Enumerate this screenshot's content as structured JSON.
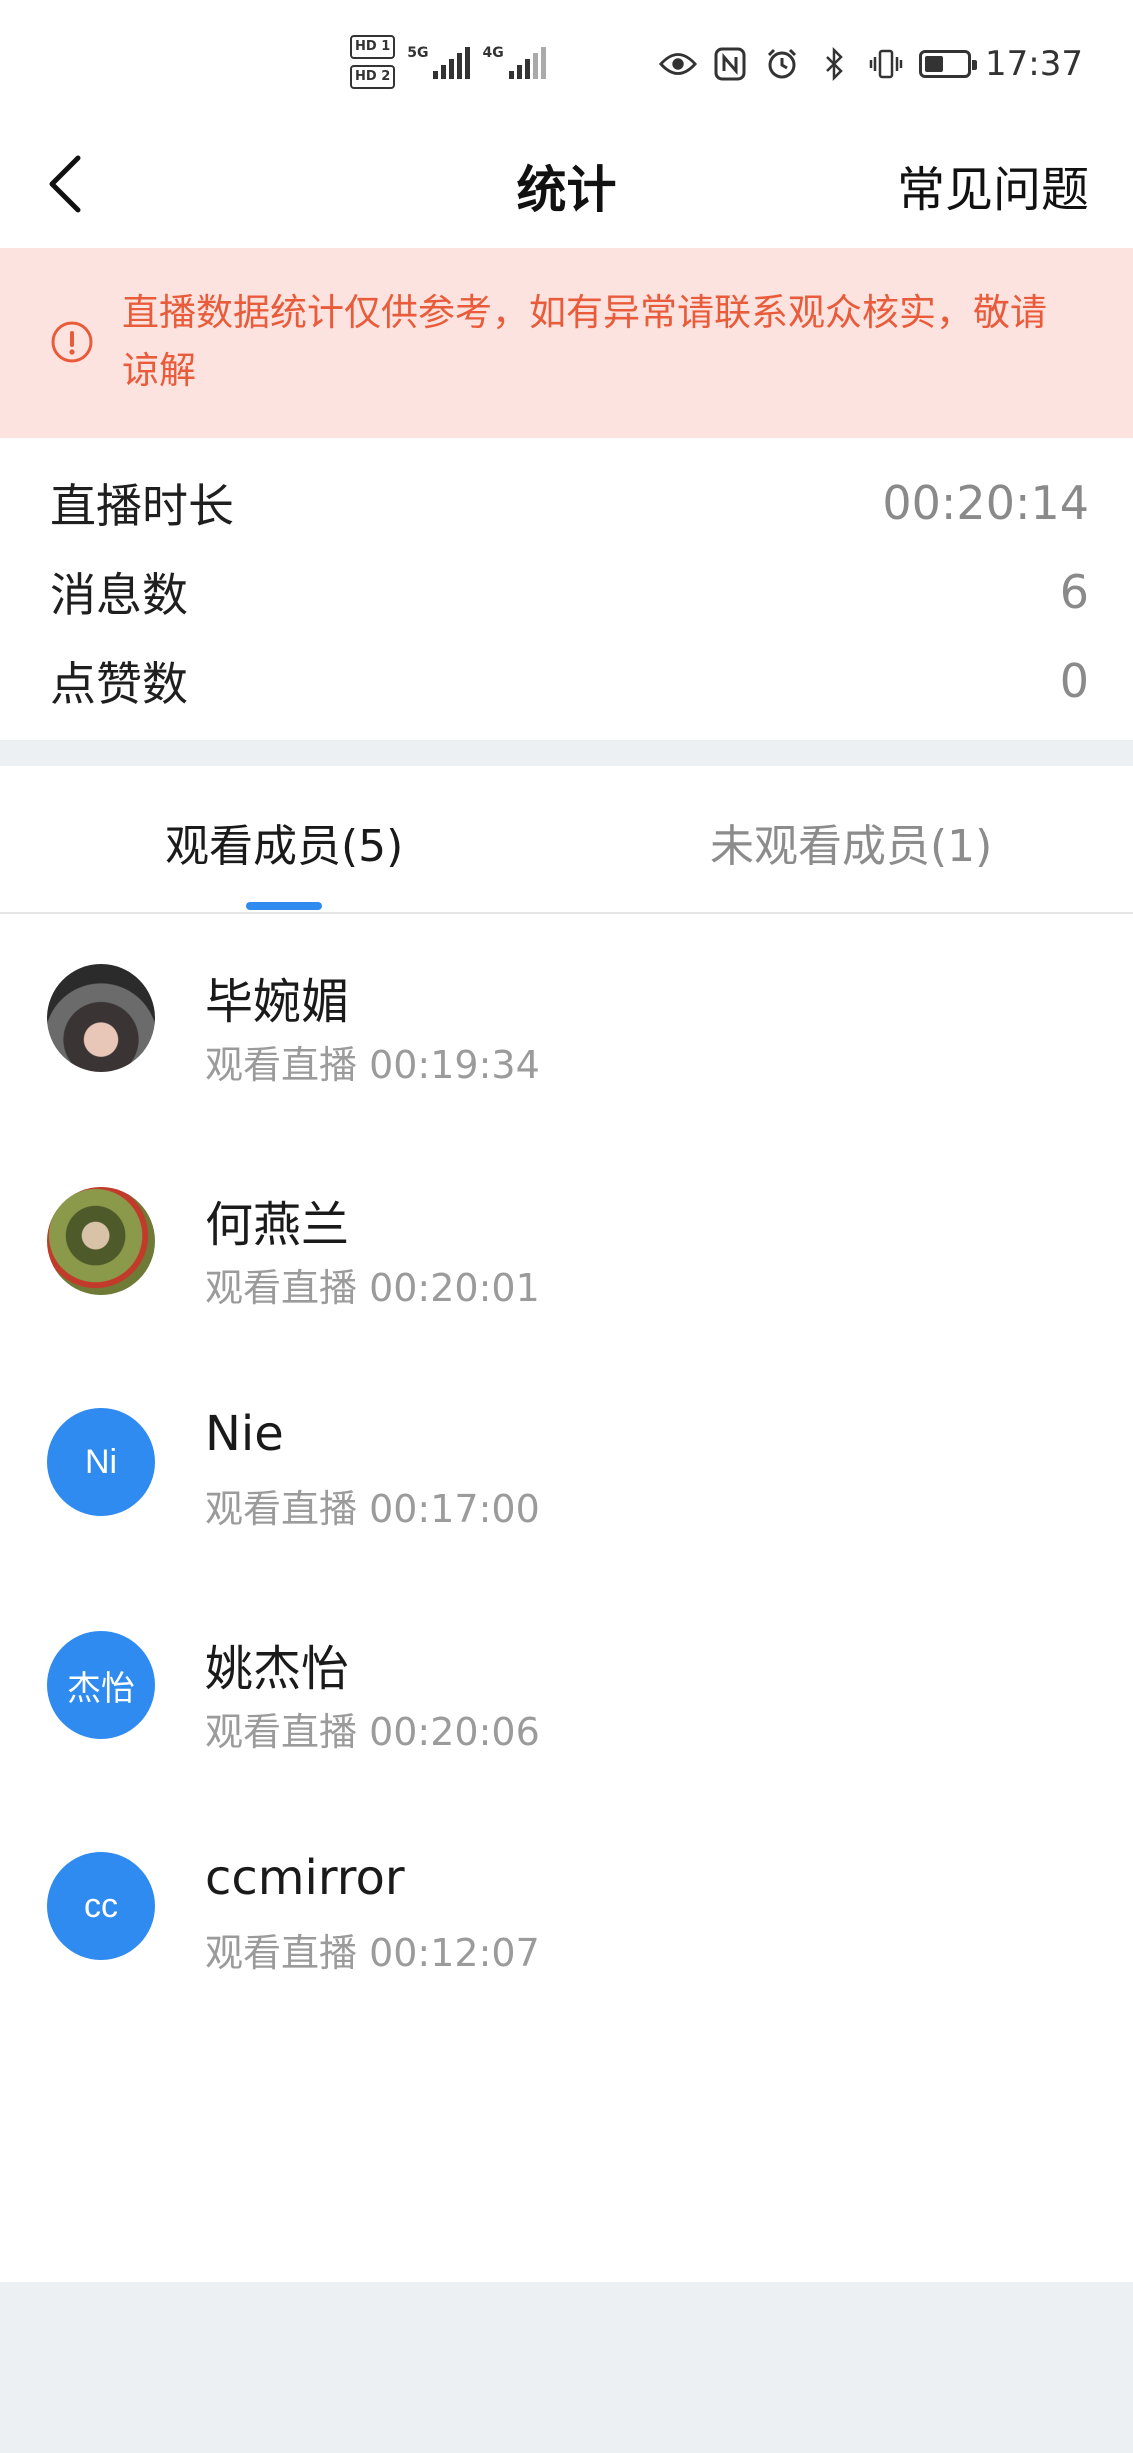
{
  "status_bar": {
    "hd1": "HD 1",
    "hd2": "HD 2",
    "net1": "5G",
    "net2": "4G",
    "time": "17:37",
    "icons": [
      "eye-icon",
      "nfc-icon",
      "alarm-icon",
      "bluetooth-icon",
      "vibrate-icon",
      "battery-icon"
    ]
  },
  "nav": {
    "title": "统计",
    "faq_label": "常见问题"
  },
  "notice": {
    "text": "直播数据统计仅供参考，如有异常请联系观众核实，敬请谅解",
    "color": "#e85c3b",
    "background": "#fde3df"
  },
  "stats": [
    {
      "label": "直播时长",
      "value": "00:20:14"
    },
    {
      "label": "消息数",
      "value": "6"
    },
    {
      "label": "点赞数",
      "value": "0"
    }
  ],
  "tabs": [
    {
      "label": "观看成员(5)",
      "active": true
    },
    {
      "label": "未观看成员(1)",
      "active": false
    }
  ],
  "accent_color": "#2f8bf0",
  "members": [
    {
      "name": "毕婉媚",
      "avatar_text": "",
      "avatar_type": "photo",
      "sub": "观看直播 00:19:34"
    },
    {
      "name": "何燕兰",
      "avatar_text": "",
      "avatar_type": "photo",
      "sub": "观看直播 00:20:01"
    },
    {
      "name": "Nie",
      "avatar_text": "Ni",
      "avatar_type": "initials",
      "sub": "观看直播 00:17:00"
    },
    {
      "name": "姚杰怡",
      "avatar_text": "杰怡",
      "avatar_type": "initials",
      "sub": "观看直播 00:20:06"
    },
    {
      "name": "ccmirror",
      "avatar_text": "cc",
      "avatar_type": "initials",
      "sub": "观看直播 00:12:07"
    }
  ]
}
